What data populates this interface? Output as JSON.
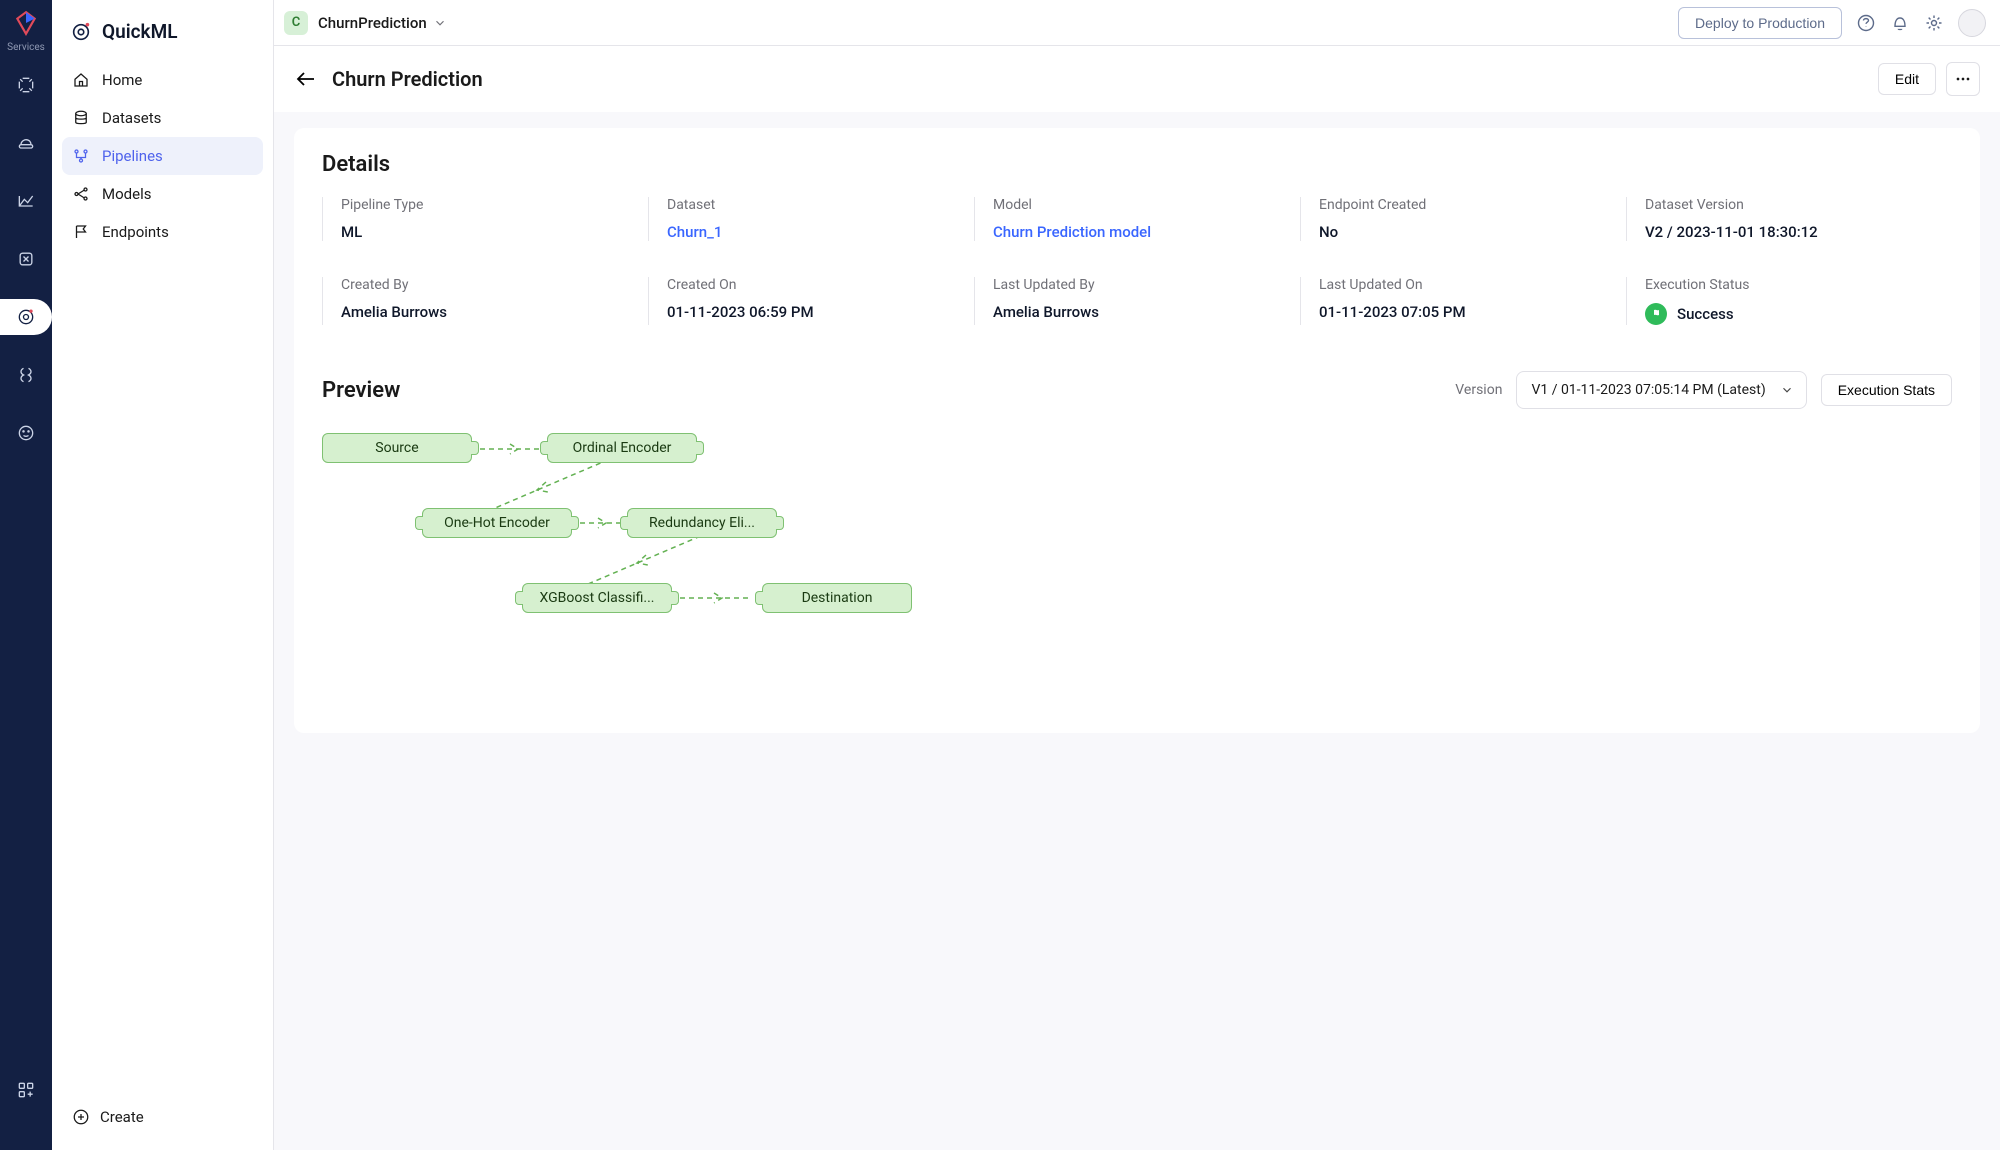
{
  "workspace": {
    "initial": "C",
    "name": "ChurnPrediction"
  },
  "product": "QuickML",
  "deploy_btn": "Deploy to Production",
  "iconbar_services": "Services",
  "nav": {
    "home": "Home",
    "datasets": "Datasets",
    "pipelines": "Pipelines",
    "models": "Models",
    "endpoints": "Endpoints",
    "create": "Create"
  },
  "page": {
    "title": "Churn Prediction",
    "edit": "Edit"
  },
  "details": {
    "heading": "Details",
    "pipeline_type": {
      "label": "Pipeline Type",
      "value": "ML"
    },
    "dataset": {
      "label": "Dataset",
      "value": "Churn_1"
    },
    "model": {
      "label": "Model",
      "value": "Churn Prediction model"
    },
    "endpoint_created": {
      "label": "Endpoint Created",
      "value": "No"
    },
    "dataset_version": {
      "label": "Dataset Version",
      "value": "V2 / 2023-11-01 18:30:12"
    },
    "created_by": {
      "label": "Created By",
      "value": "Amelia Burrows"
    },
    "created_on": {
      "label": "Created On",
      "value": "01-11-2023 06:59 PM"
    },
    "last_updated_by": {
      "label": "Last Updated By",
      "value": "Amelia Burrows"
    },
    "last_updated_on": {
      "label": "Last Updated On",
      "value": "01-11-2023 07:05 PM"
    },
    "execution_status": {
      "label": "Execution Status",
      "value": "Success"
    }
  },
  "preview": {
    "heading": "Preview",
    "version_label": "Version",
    "version_value": "V1 / 01-11-2023 07:05:14 PM (Latest)",
    "exec_btn": "Execution Stats",
    "nodes": {
      "source": "Source",
      "ordinal": "Ordinal Encoder",
      "onehot": "One-Hot Encoder",
      "redundancy": "Redundancy Eli...",
      "xgb": "XGBoost Classifi...",
      "dest": "Destination"
    }
  }
}
